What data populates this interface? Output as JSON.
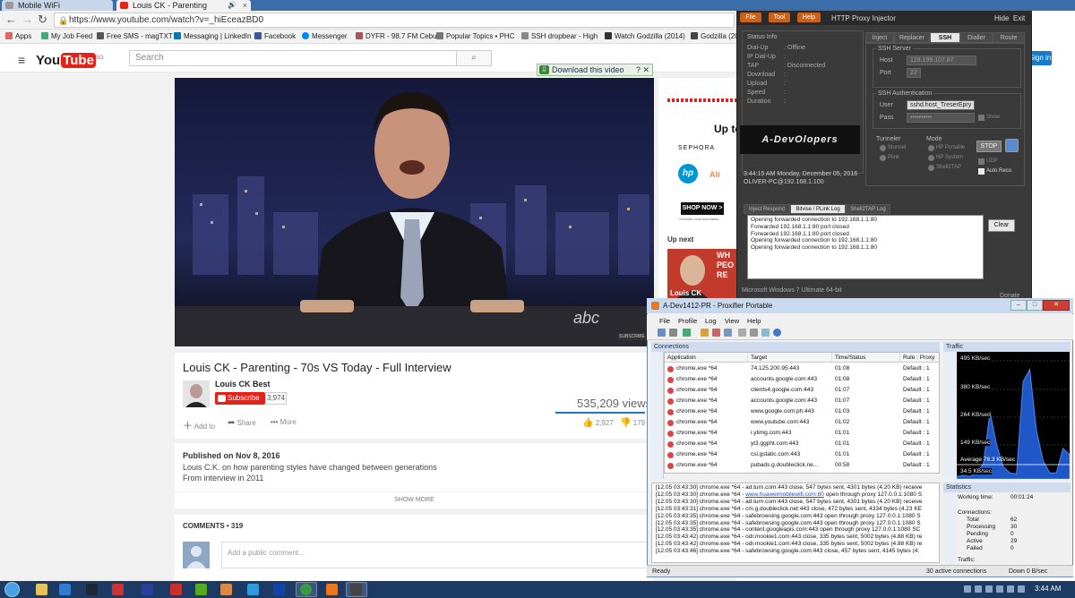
{
  "browser": {
    "tabs": [
      {
        "title": "Mobile WiFi"
      },
      {
        "title": "Louis CK - Parenting",
        "icon": "volume-icon"
      }
    ],
    "url": "https://www.youtube.com/watch?v=_hiEceazBD0",
    "bookmarks": [
      {
        "label": "Apps"
      },
      {
        "label": "My Job Feed"
      },
      {
        "label": "Free SMS - magTXT"
      },
      {
        "label": "Messaging | LinkedIn"
      },
      {
        "label": "Facebook"
      },
      {
        "label": "Messenger"
      },
      {
        "label": "DYFR - 98.7 FM Cebu"
      },
      {
        "label": "Popular Topics • PHC"
      },
      {
        "label": "SSH dropbear - High"
      },
      {
        "label": "Watch Godzilla (2014)"
      },
      {
        "label": "Godzilla (2014)"
      }
    ]
  },
  "youtube": {
    "logo_left": "You",
    "logo_right": "Tube",
    "logo_region": "SG",
    "search_placeholder": "Search",
    "signin": "Sign in",
    "download_bar": "Download this video",
    "download_help": "?",
    "download_close": "✕",
    "video": {
      "title": "Louis CK - Parenting - 70s VS Today - Full Interview",
      "channel": "Louis CK Best",
      "subscribe": "Subscribe",
      "subscribers": "3,974",
      "views": "535,209 views",
      "likes": "2,927",
      "dislikes": "179",
      "add_to": "Add to",
      "share": "Share",
      "more": "More",
      "watermark": "abc",
      "subscribe_overlay": "SUBSCRIBE",
      "published": "Published on Nov 8, 2016",
      "description_1": "Louis C.K. on how parenting styles have changed between generations",
      "description_2": "From interview in 2011",
      "show_more": "SHOW MORE"
    },
    "comments_label": "COMMENTS • 319",
    "comment_placeholder": "Add a public comment...",
    "ad": {
      "up_to": "Up to",
      "sephora": "SEPHORA",
      "hp": "hp",
      "ali": "Ali",
      "shop_now": "SHOP NOW >",
      "shop_sub": "*exclude local merchants"
    },
    "up_next": "Up next",
    "next_thumb_text_1": "WH",
    "next_thumb_text_2": "PEO",
    "next_thumb_text_3": "RE",
    "next_thumb_label": "Louis CK"
  },
  "proxy_injector": {
    "menu_file": "File",
    "menu_tool": "Tool",
    "menu_help": "Help",
    "title": "HTTP Proxy Injector",
    "hide": "Hide",
    "exit": "Exit",
    "status_info": "Status Info",
    "status_rows": [
      {
        "label": "Dial-Up",
        "value": ": Offline"
      },
      {
        "label": "IP Dial-Up",
        "value": ":"
      },
      {
        "label": "TAP",
        "value": ": Disconnected"
      },
      {
        "label": "Download",
        "value": ":"
      },
      {
        "label": "Upload",
        "value": ":"
      },
      {
        "label": "Speed",
        "value": ":"
      },
      {
        "label": "Duration",
        "value": ":"
      }
    ],
    "banner": "A-DevOlopers",
    "time_info": "3:44:15 AM     Monday, December 05, 2016",
    "peer_info": "OLIVER-PC@192.168.1.100",
    "tabs": [
      "Inject",
      "Replacer",
      "SSH",
      "Dialler",
      "Route"
    ],
    "active_tab": "SSH",
    "ssh_server": "SSH Server",
    "host_label": "Host",
    "host_value": "128.199.107.87",
    "port_label": "Port",
    "port_value": "22",
    "ssh_auth": "SSH Authentication",
    "user_label": "User",
    "user_value": "sshd.host_TreserEpry",
    "pass_label": "Pass",
    "pass_value": "••••••••••",
    "show_label": "Show",
    "tunneler": "Tunneler",
    "tunneler_opts": [
      "Stunnel",
      "Plink"
    ],
    "mode": "Mode",
    "mode_opts": [
      "HP Portable",
      "HP System",
      "Shell2TAP"
    ],
    "udp": "UDP",
    "auto_reco": "Auto Reco",
    "stop": "STOP",
    "log_tabs": [
      "Inject Respond",
      "Bitvise / PLink Log",
      "Shell2TAP Log"
    ],
    "log_lines": [
      "Opening forwarded connection to 192.168.1.1:80",
      "Forwarded 192.168.1.1:80 port closed",
      "Forwarded 192.168.1.1:80 port closed",
      "Opening forwarded connection to 192.168.1.1:80",
      "Opening forwarded connection to 192.168.1.1:80"
    ],
    "clear": "Clear",
    "os_status": "Microsoft Windows 7 Ultimate 64-bit",
    "donate": "Donate"
  },
  "proxifier": {
    "title": "A-Dev1412-PR - Proxifier Portable",
    "menu": [
      "File",
      "Profile",
      "Log",
      "View",
      "Help"
    ],
    "connections_title": "Connections",
    "columns": [
      "Application",
      "Target",
      "Time/Status",
      "Rule : Proxy"
    ],
    "rows": [
      {
        "app": "chrome.exe *64",
        "target": "74.125.200.95:443",
        "time": "01:08",
        "rule": "Default : 1"
      },
      {
        "app": "chrome.exe *64",
        "target": "accounts.google.com:443",
        "time": "01:08",
        "rule": "Default : 1"
      },
      {
        "app": "chrome.exe *64",
        "target": "clients4.google.com:443",
        "time": "01:07",
        "rule": "Default : 1"
      },
      {
        "app": "chrome.exe *64",
        "target": "accounts.google.com:443",
        "time": "01:07",
        "rule": "Default : 1"
      },
      {
        "app": "chrome.exe *64",
        "target": "www.google.com.ph:443",
        "time": "01:03",
        "rule": "Default : 1"
      },
      {
        "app": "chrome.exe *64",
        "target": "www.youtube.com:443",
        "time": "01:02",
        "rule": "Default : 1"
      },
      {
        "app": "chrome.exe *64",
        "target": "i.ytimg.com:443",
        "time": "01:01",
        "rule": "Default : 1"
      },
      {
        "app": "chrome.exe *64",
        "target": "yt3.ggpht.com:443",
        "time": "01:01",
        "rule": "Default : 1"
      },
      {
        "app": "chrome.exe *64",
        "target": "csi.gstatic.com:443",
        "time": "01:01",
        "rule": "Default : 1"
      },
      {
        "app": "chrome.exe *64",
        "target": "pubads.g.doubleclick.ne...",
        "time": "00:58",
        "rule": "Default : 1"
      }
    ],
    "traffic_title": "Traffic",
    "traffic_labels": [
      "495 KB/sec",
      "380 KB/sec",
      "264 KB/sec",
      "149 KB/sec",
      "Average 78.3 KB/sec",
      "34.5 KB/sec"
    ],
    "traffic_series": [
      0.02,
      0.03,
      0.02,
      0.05,
      0.12,
      0.55,
      0.28,
      0.1,
      0.05,
      0.04,
      0.8,
      0.9,
      0.4,
      0.15,
      0.05,
      0.05,
      0.25,
      0.2
    ],
    "log_lines": [
      {
        "text": "[12.05 03:43:30] chrome.exe *64 - ad.turn.com:443 close, 547 bytes sent, 4301 bytes (4.20 KB) receive"
      },
      {
        "text": "[12.05 03:43:30] chrome.exe *64 - ",
        "link": "www.huaweimobilewifi.com:80",
        "rest": " open through proxy 127.0.0.1:1080 S"
      },
      {
        "text": "[12.05 03:43:30] chrome.exe *64 - ad.turn.com:443 close, 547 bytes sent, 4301 bytes (4.20 KB) receive"
      },
      {
        "text": "[12.05 03:43:31] chrome.exe *64 - cm.g.doubleclick.net:443 close, 472 bytes sent, 4334 bytes (4.23 KE"
      },
      {
        "text": "[12.05 03:43:35] chrome.exe *64 - safebrowsing.google.com:443 open through proxy 127.0.0.1:1080 S"
      },
      {
        "text": "[12.05 03:43:35] chrome.exe *64 - safebrowsing.google.com:443 open through proxy 127.0.0.1:1080 S"
      },
      {
        "text": "[12.05 03:43:35] chrome.exe *64 - content.googleapis.com:443 open through proxy 127.0.0.1:1080 SC"
      },
      {
        "text": "[12.05 03:43:42] chrome.exe *64 - odr.mookie1.com:443 close, 335 bytes sent, 5002 bytes (4.88 KB) re"
      },
      {
        "text": "[12.05 03:43:42] chrome.exe *64 - odr.mookie1.com:443 close, 335 bytes sent, 5002 bytes (4.88 KB) re"
      },
      {
        "text": "[12.05 03:43:46] chrome.exe *64 - safebrowsing.google.com:443 close, 457 bytes sent, 4145 bytes (4."
      }
    ],
    "statistics_title": "Statistics",
    "stats": [
      {
        "label": "Working time:",
        "value": "00:01:24"
      },
      {
        "label": "Connections:",
        "value": ""
      },
      {
        "label": "Total",
        "value": "62"
      },
      {
        "label": "Processing",
        "value": "30"
      },
      {
        "label": "Pending",
        "value": "0"
      },
      {
        "label": "Active",
        "value": "29"
      },
      {
        "label": "Failed",
        "value": "0"
      },
      {
        "label": "Traffic:",
        "value": ""
      }
    ],
    "status_ready": "Ready",
    "status_active": "30 active connections",
    "status_down": "Down 0 B/sec"
  },
  "taskbar": {
    "clock": "3:44 AM"
  }
}
